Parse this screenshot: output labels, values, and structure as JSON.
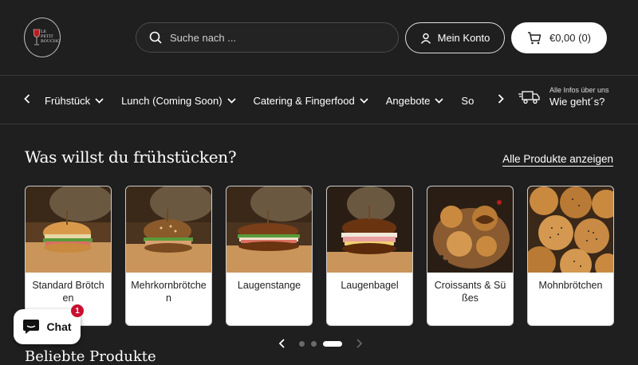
{
  "header": {
    "logo_text": "LE PETIT BOUCHON",
    "search_placeholder": "Suche nach ...",
    "account_label": "Mein Konto",
    "cart_label": "€0,00 (0)"
  },
  "nav": {
    "items": [
      {
        "label": "Frühstück"
      },
      {
        "label": "Lunch (Coming Soon)"
      },
      {
        "label": "Catering & Fingerfood"
      },
      {
        "label": "Angebote"
      },
      {
        "label": "So"
      }
    ],
    "info_small": "Alle Infos über uns",
    "info_big": "Wie geht´s?"
  },
  "section": {
    "title": "Was willst du frühstücken?",
    "all_products": "Alle Produkte anzeigen"
  },
  "products": [
    {
      "label": "Standard Brötchen"
    },
    {
      "label": "Mehrkornbrötchen"
    },
    {
      "label": "Laugenstange"
    },
    {
      "label": "Laugenbagel"
    },
    {
      "label": "Croissants & Süßes"
    },
    {
      "label": "Mohnbrötchen"
    }
  ],
  "carousel": {
    "pages": 3,
    "active": 3
  },
  "next_section": {
    "title": "Beliebte Produkte"
  },
  "chat": {
    "label": "Chat",
    "badge": "1"
  },
  "colors": {
    "background": "#1f1f1f",
    "accent": "#ffffff",
    "badge": "#c8102e"
  }
}
